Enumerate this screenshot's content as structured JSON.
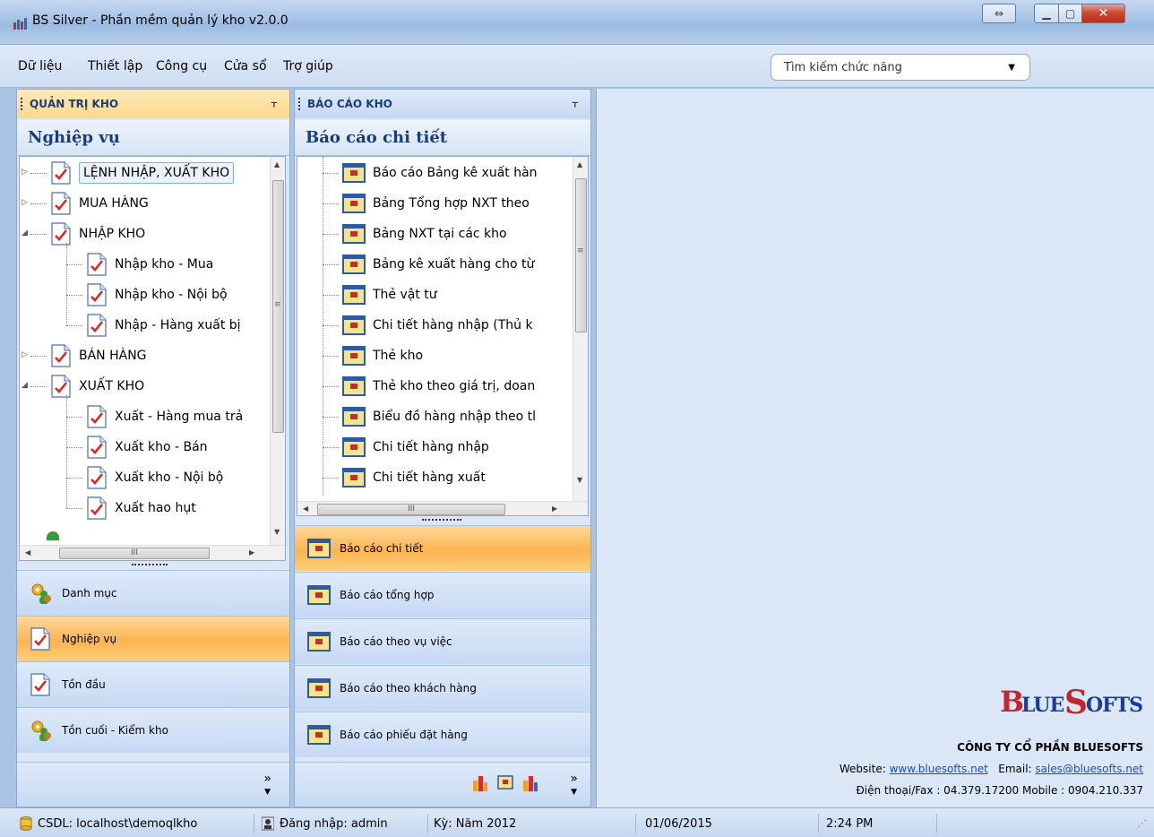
{
  "window": {
    "title": "BS Silver - Phần mềm quản lý kho v2.0.0"
  },
  "menu": {
    "items": [
      "Dữ liệu",
      "Thiết lập",
      "Công cụ",
      "Cửa sổ",
      "Trợ giúp"
    ],
    "search_placeholder": "Tìm kiếm chức năng"
  },
  "left_panel": {
    "header": "QUẢN TRỊ KHO",
    "section_title": "Nghiệp vụ",
    "tree": [
      {
        "label": "LỆNH NHẬP, XUẤT KHO",
        "level": 0,
        "expander": "collapsed",
        "selected": true
      },
      {
        "label": "MUA HÀNG",
        "level": 0,
        "expander": "collapsed"
      },
      {
        "label": "NHẬP KHO",
        "level": 0,
        "expander": "expanded"
      },
      {
        "label": "Nhập kho - Mua",
        "level": 1
      },
      {
        "label": "Nhập kho - Nội bộ",
        "level": 1
      },
      {
        "label": "Nhập - Hàng xuất bị",
        "level": 1
      },
      {
        "label": "BÁN HÀNG",
        "level": 0,
        "expander": "collapsed"
      },
      {
        "label": "XUẤT KHO",
        "level": 0,
        "expander": "expanded"
      },
      {
        "label": "Xuất - Hàng mua trả",
        "level": 1
      },
      {
        "label": "Xuất kho - Bán",
        "level": 1
      },
      {
        "label": "Xuất kho - Nội bộ",
        "level": 1
      },
      {
        "label": "Xuất hao hụt",
        "level": 1
      }
    ],
    "nav_buttons": [
      {
        "label": "Danh mục",
        "icon": "gear-people-icon",
        "active": false
      },
      {
        "label": "Nghiệp vụ",
        "icon": "checklist-icon",
        "active": true
      },
      {
        "label": "Tồn đầu",
        "icon": "checklist-icon",
        "active": false
      },
      {
        "label": "Tồn cuối - Kiểm kho",
        "icon": "gear-people-icon",
        "active": false
      }
    ]
  },
  "mid_panel": {
    "header": "BÁO CÁO KHO",
    "section_title": "Báo cáo chi tiết",
    "tree": [
      "Báo cáo Bảng kê xuất hàn",
      "Bảng Tổng hợp NXT theo",
      "Bảng NXT tại các kho",
      "Bảng kê xuất hàng cho từ",
      "Thẻ vật tư",
      "Chi tiết hàng nhập (Thủ k",
      "Thẻ kho",
      "Thẻ kho theo giá trị, doan",
      "Biểu đồ hàng nhập theo tl",
      "Chi tiết hàng nhập",
      "Chi tiết hàng xuất"
    ],
    "nav_buttons": [
      {
        "label": "Báo cáo chi tiết",
        "active": true
      },
      {
        "label": "Báo cáo tổng hợp",
        "active": false
      },
      {
        "label": "Báo cáo theo vụ việc",
        "active": false
      },
      {
        "label": "Báo cáo theo khách hàng",
        "active": false
      },
      {
        "label": "Báo cáo phiếu đặt hàng",
        "active": false
      }
    ],
    "scroll_glyph": "III"
  },
  "company": {
    "logo_text": "BLUESOFTS",
    "name": "CÔNG TY CỔ PHẦN BLUESOFTS",
    "website_label": "Website:",
    "website": "www.bluesofts.net",
    "email_label": "Email:",
    "email": "sales@bluesofts.net",
    "phone_line": "Điện thoại/Fax : 04.379.17200  Mobile : 0904.210.337"
  },
  "status": {
    "db": "CSDL: localhost\\demoqlkho",
    "login": "Đăng nhập: admin",
    "period": "Kỳ: Năm 2012",
    "date": "01/06/2015",
    "time": "2:24 PM"
  },
  "colors": {
    "accent_orange": "#fbb450",
    "panel_blue": "#dbe7f6",
    "brand_red": "#c0282d"
  }
}
